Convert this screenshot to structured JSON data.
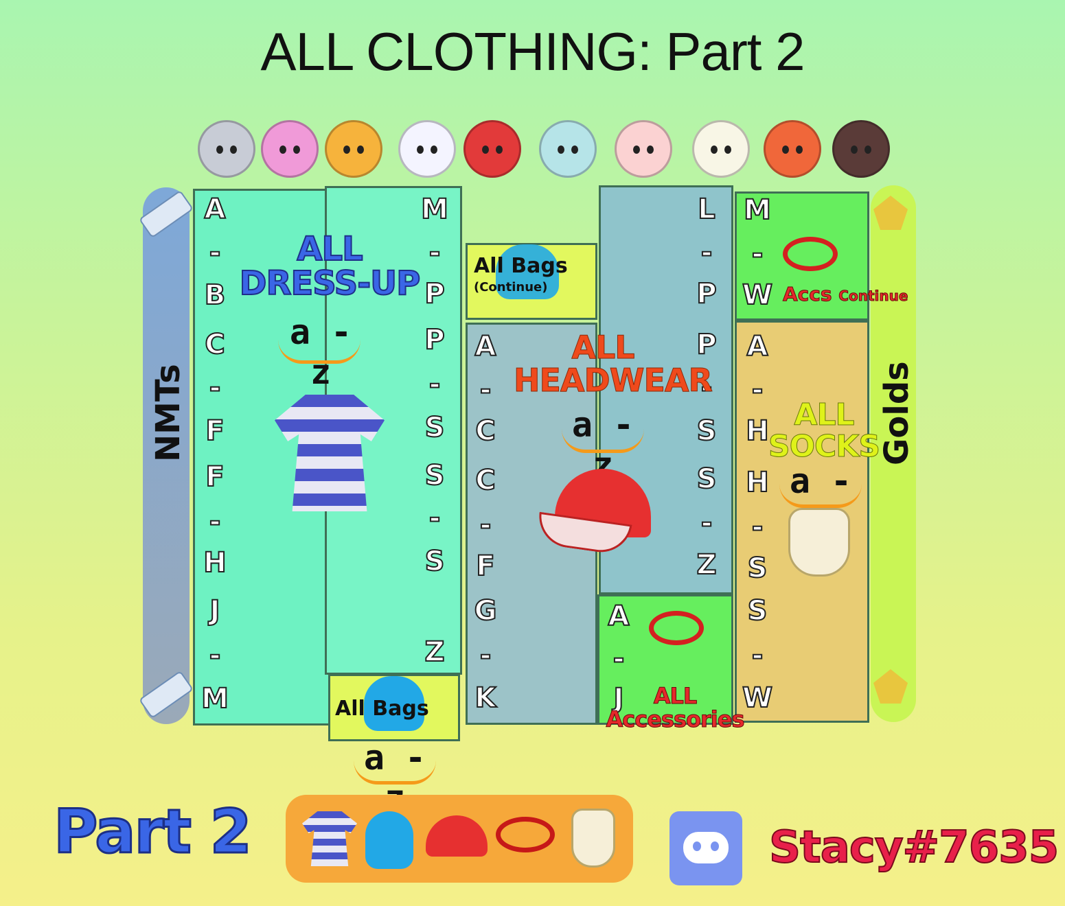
{
  "title": "ALL CLOTHING: Part 2",
  "villagers": [
    "raymond-icon",
    "bear-pink-icon",
    "bear-stitches-icon",
    "bear-judy-icon",
    "bird-red-icon",
    "sheep-blue-icon",
    "sheep-pink-icon",
    "cub-marshal-icon",
    "wolf-audie-icon",
    "horse-icon"
  ],
  "left_bar_label": "NMTs",
  "right_bar_label": "Golds",
  "columns": {
    "dressup_left": [
      "A",
      "-",
      "B",
      "C",
      "-",
      "F",
      "F",
      "-",
      "H",
      "J",
      "-",
      "M"
    ],
    "dressup_right": [
      "M",
      "-",
      "P",
      "P",
      "-",
      "S",
      "S",
      "-",
      "S",
      "Z"
    ],
    "bags_left": [
      "A",
      "-",
      "C",
      "C",
      "-",
      "F",
      "G",
      "-",
      "K"
    ],
    "headwear_right": [
      "L",
      "-",
      "P",
      "P",
      "-",
      "S",
      "S",
      "-",
      "Z"
    ],
    "accessories_a": [
      "A",
      "-",
      "J"
    ],
    "accs_continue": [
      "M",
      "-",
      "W"
    ],
    "socks_col": [
      "A",
      "-",
      "H",
      "H",
      "-",
      "S",
      "S",
      "-",
      "W"
    ]
  },
  "labels": {
    "dressup_line1": "ALL",
    "dressup_line2": "DRESS-UP",
    "az": "a - z",
    "bags_continue": "All Bags",
    "bags_continue_sub": "(Continue)",
    "headwear_line1": "ALL",
    "headwear_line2": "HEADWEAR",
    "accs_continue": "Accs",
    "accs_continue_word": "Continue",
    "socks_line1": "ALL",
    "socks_line2": "SOCKS",
    "all_bags": "All Bags",
    "accessories_line1": "ALL",
    "accessories_line2": "Accessories"
  },
  "footer": {
    "part": "Part 2",
    "icons": [
      "shirt-icon",
      "backpack-icon",
      "cap-icon",
      "glasses-icon",
      "socks-icon"
    ],
    "discord_icon": "discord-icon",
    "contact": "Stacy#7635"
  },
  "colors": {
    "dressup": "#6ef2c2",
    "bags": "#9cc3c8",
    "accessories": "#66ee5e",
    "socks": "#e8cc74",
    "yellow_box": "#e2f85e",
    "blue_text": "#3a66e6",
    "red_text": "#e4292b",
    "orange_text": "#ef4a1c",
    "yellow_text": "#dff21a",
    "contact": "#e8204a"
  }
}
